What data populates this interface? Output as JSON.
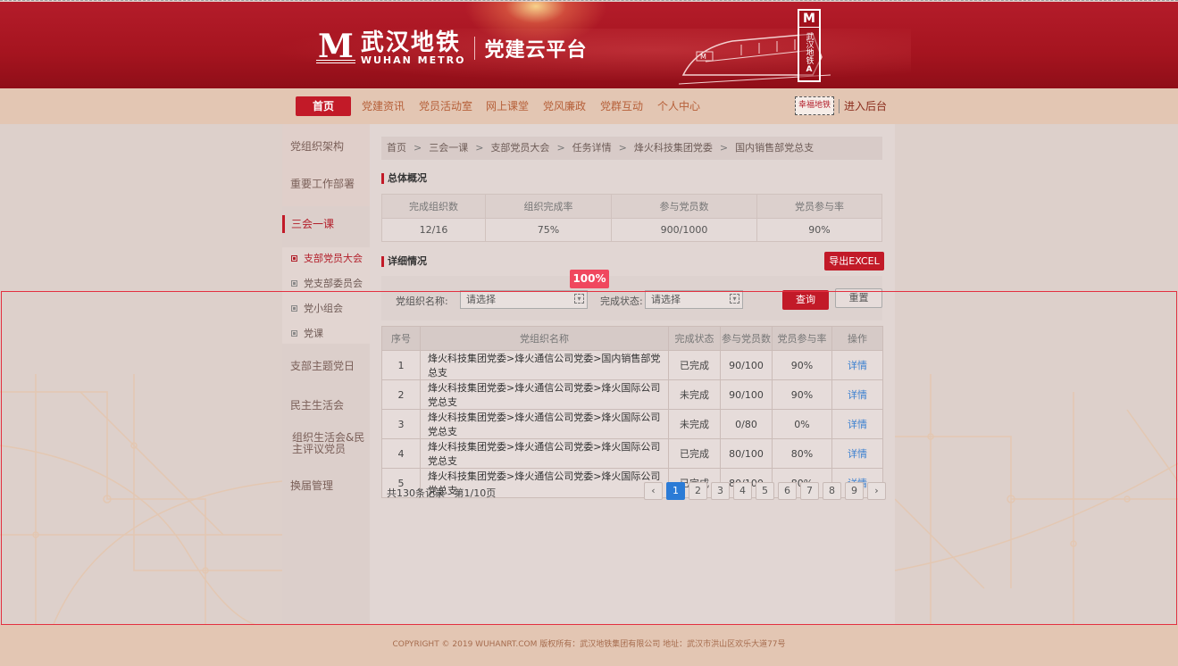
{
  "header": {
    "logo_mark": "M",
    "logo_cn": "武汉地铁",
    "logo_en": "WUHAN METRO",
    "subtitle": "党建云平台",
    "tower_text": "武汉地铁",
    "tower_letter": "A"
  },
  "nav": {
    "items": [
      "首页",
      "党建资讯",
      "党员活动室",
      "网上课堂",
      "党风廉政",
      "党群互动",
      "个人中心"
    ],
    "stamp": "幸福地铁",
    "admin": "进入后台"
  },
  "sidebar": {
    "items": [
      "党组织架构",
      "重要工作部署",
      "三会一课",
      "支部主题党日",
      "民主生活会",
      "组织生活会&民主评议党员",
      "换届管理"
    ],
    "sub_items": [
      "支部党员大会",
      "党支部委员会",
      "党小组会",
      "党课"
    ]
  },
  "breadcrumb": [
    "首页",
    "三会一课",
    "支部党员大会",
    "任务详情",
    "烽火科技集团党委",
    "国内销售部党总支"
  ],
  "summary": {
    "title": "总体概况",
    "headers": [
      "完成组织数",
      "组织完成率",
      "参与党员数",
      "党员参与率"
    ],
    "values": [
      "12/16",
      "75%",
      "900/1000",
      "90%"
    ]
  },
  "detail": {
    "title": "详细情况",
    "export_label": "导出EXCEL",
    "zoom": "100%",
    "filter": {
      "org_label": "党组织名称:",
      "org_value": "请选择",
      "status_label": "完成状态:",
      "status_value": "请选择",
      "query_label": "查询",
      "reset_label": "重置"
    },
    "headers": [
      "序号",
      "党组织名称",
      "完成状态",
      "参与党员数",
      "党员参与率",
      "操作"
    ],
    "rows": [
      [
        "1",
        "烽火科技集团党委>烽火通信公司党委>国内销售部党总支",
        "已完成",
        "90/100",
        "90%",
        "详情"
      ],
      [
        "2",
        "烽火科技集团党委>烽火通信公司党委>烽火国际公司党总支",
        "未完成",
        "90/100",
        "90%",
        "详情"
      ],
      [
        "3",
        "烽火科技集团党委>烽火通信公司党委>烽火国际公司党总支",
        "未完成",
        "0/80",
        "0%",
        "详情"
      ],
      [
        "4",
        "烽火科技集团党委>烽火通信公司党委>烽火国际公司党总支",
        "已完成",
        "80/100",
        "80%",
        "详情"
      ],
      [
        "5",
        "烽火科技集团党委>烽火通信公司党委>烽火国际公司党总支",
        "已完成",
        "80/100",
        "80%",
        "详情"
      ]
    ],
    "total_text": "共130条记录",
    "page_text": "第1/10页",
    "pages": [
      "1",
      "2",
      "3",
      "4",
      "5",
      "6",
      "7",
      "8",
      "9"
    ],
    "current_page": "1"
  },
  "footer": {
    "text": "COPYRIGHT © 2019 WUHANRT.COM  版权所有：武汉地铁集团有限公司  地址：武汉市洪山区欢乐大道77号"
  },
  "colors": {
    "brand_red": "#c21a28",
    "link_blue": "#3a7fd0",
    "page_blue": "#2b7bd6"
  }
}
